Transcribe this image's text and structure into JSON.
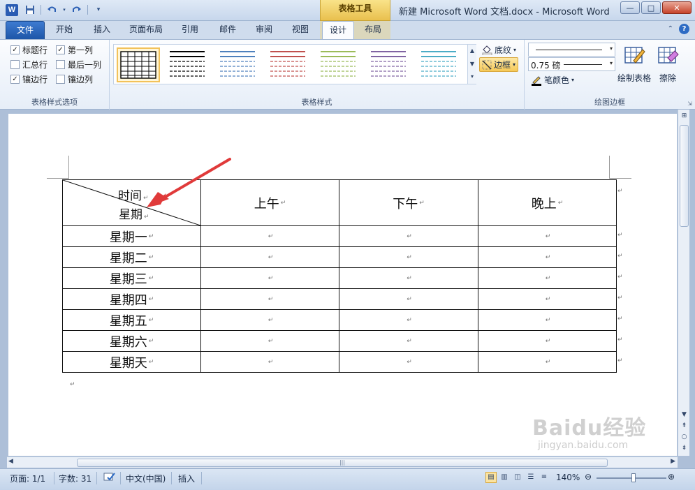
{
  "window": {
    "title": "新建 Microsoft Word 文档.docx - Microsoft Word",
    "context_tab": "表格工具",
    "app_icon": "W",
    "controls": {
      "minimize": "—",
      "maximize": "□",
      "close": "✕"
    }
  },
  "tabs": [
    {
      "label": "文件"
    },
    {
      "label": "开始"
    },
    {
      "label": "插入"
    },
    {
      "label": "页面布局"
    },
    {
      "label": "引用"
    },
    {
      "label": "邮件"
    },
    {
      "label": "审阅"
    },
    {
      "label": "视图"
    },
    {
      "label": "设计"
    },
    {
      "label": "布局"
    }
  ],
  "ribbon": {
    "style_options": {
      "group_label": "表格样式选项",
      "items": [
        {
          "label": "标题行",
          "checked": "✓"
        },
        {
          "label": "第一列",
          "checked": "✓"
        },
        {
          "label": "汇总行",
          "checked": ""
        },
        {
          "label": "最后一列",
          "checked": ""
        },
        {
          "label": "镶边行",
          "checked": "✓"
        },
        {
          "label": "镶边列",
          "checked": ""
        }
      ]
    },
    "table_styles": {
      "group_label": "表格样式",
      "shading_label": "底纹",
      "borders_label": "边框",
      "thumb_colors": [
        "#000000",
        "#000000",
        "#4f81bd",
        "#c0504d",
        "#9bbb59",
        "#8064a2",
        "#4bacc6"
      ]
    },
    "draw_borders": {
      "group_label": "绘图边框",
      "line_weight": "0.75 磅",
      "pen_color_label": "笔颜色",
      "draw_table_label": "绘制表格",
      "eraser_label": "擦除"
    }
  },
  "document": {
    "headers": [
      "上午",
      "下午",
      "晚上"
    ],
    "diagonal_header": {
      "top": "时间",
      "bottom": "星期"
    },
    "rows": [
      "星期一",
      "星期二",
      "星期三",
      "星期四",
      "星期五",
      "星期六",
      "星期天"
    ],
    "paragraph_mark": "↵"
  },
  "status": {
    "page": "页面: 1/1",
    "words": "字数: 31",
    "language": "中文(中国)",
    "mode": "插入",
    "zoom": "140%"
  },
  "watermark": {
    "main": "Baidu经验",
    "sub": "jingyan.baidu.com"
  },
  "colors": {
    "accent": "#2a5cb3",
    "context_tab": "#e9c04e",
    "annotation_arrow": "#e03a3a"
  }
}
